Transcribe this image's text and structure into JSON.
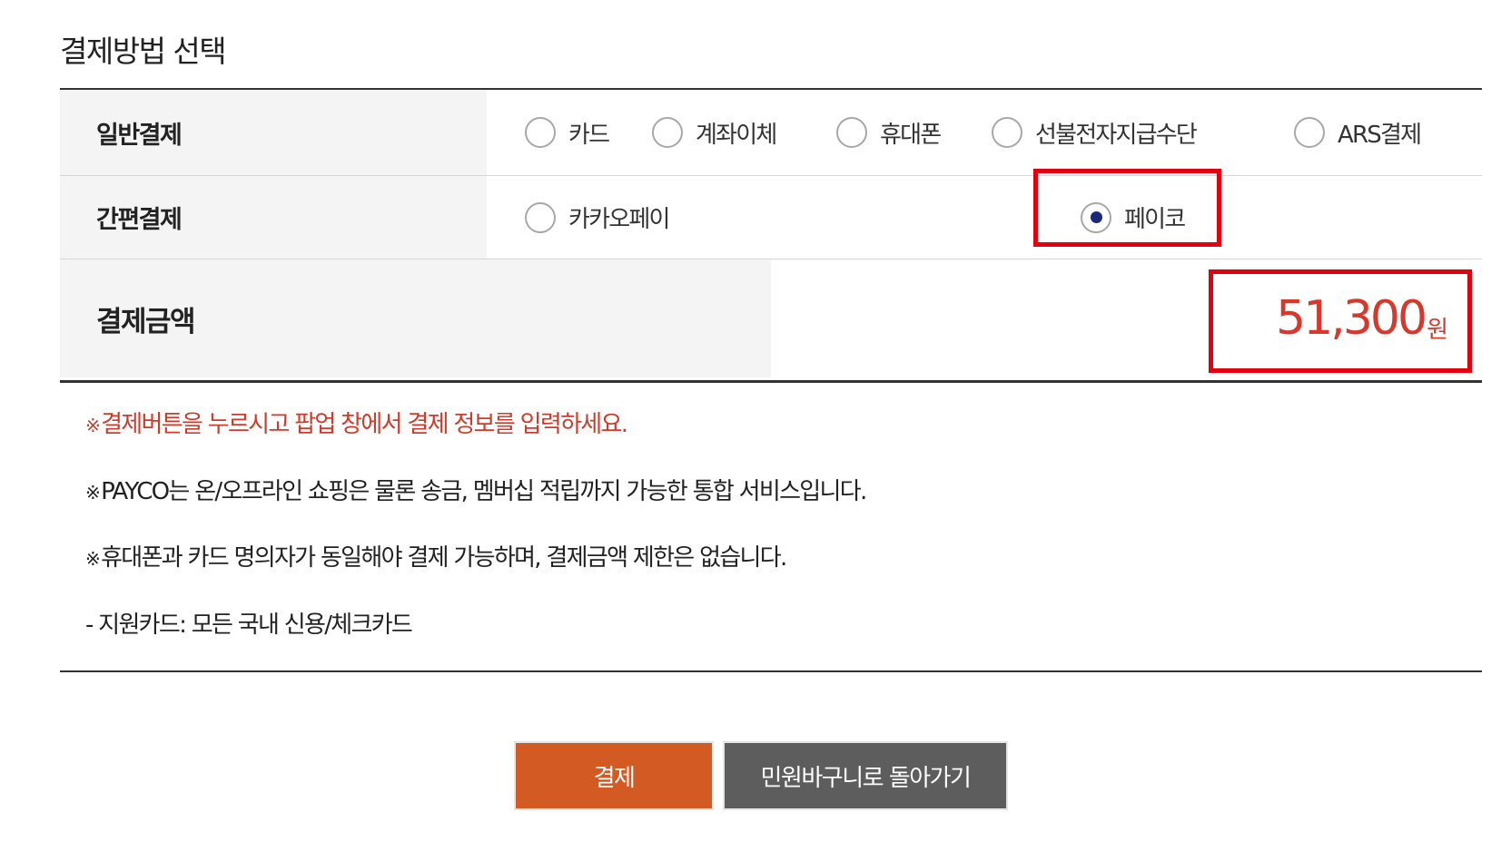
{
  "section_title": "결제방법 선택",
  "general_payment": {
    "header": "일반결제",
    "options": [
      {
        "label": "카드",
        "selected": false
      },
      {
        "label": "계좌이체",
        "selected": false
      },
      {
        "label": "휴대폰",
        "selected": false
      },
      {
        "label": "선불전자지급수단",
        "selected": false
      },
      {
        "label": "ARS결제",
        "selected": false
      }
    ]
  },
  "simple_payment": {
    "header": "간편결제",
    "options": [
      {
        "label": "카카오페이",
        "selected": false
      },
      {
        "label": "페이코",
        "selected": true
      }
    ]
  },
  "amount": {
    "header": "결제금액",
    "value": "51,300",
    "unit": "원"
  },
  "notices": {
    "mark": "※",
    "line1": "결제버튼을 누르시고 팝업 창에서 결제 정보를 입력하세요.",
    "line2": "PAYCO는 온/오프라인 쇼핑은 물론 송금, 멤버십 적립까지 가능한 통합 서비스입니다.",
    "line3": "휴대폰과 카드 명의자가 동일해야 결제 가능하며, 결제금액 제한은 없습니다.",
    "line4": "- 지원카드: 모든 국내 신용/체크카드"
  },
  "buttons": {
    "pay": "결제",
    "back": "민원바구니로 돌아가기"
  },
  "colors": {
    "highlight": "#e3000f",
    "amount": "#d8382b",
    "pay_button": "#d35a22",
    "back_button": "#5d5d5d",
    "radio_checked": "#1b2a78"
  }
}
